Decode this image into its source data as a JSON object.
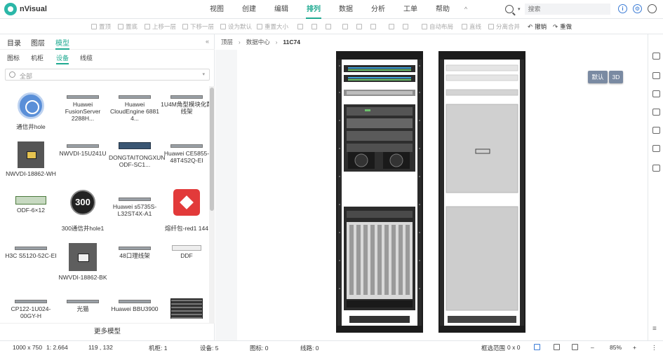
{
  "app": {
    "logo_text": "nVisual"
  },
  "menu": {
    "items": [
      "视图",
      "创建",
      "编辑",
      "排列",
      "数据",
      "分析",
      "工单",
      "帮助"
    ],
    "active_index": 3,
    "collapse_glyph": "^"
  },
  "search": {
    "placeholder": "搜索"
  },
  "top_icons": {
    "info": "i",
    "settings": "⚙"
  },
  "toolbar": {
    "front": "置顶",
    "back": "置底",
    "up": "上移一层",
    "down": "下移一层",
    "set_default": "设为默认",
    "reset_size": "重置大小",
    "auto_layout": "自动布局",
    "straight": "直线",
    "split_merge": "分离合并",
    "undo": "撤销",
    "redo": "重做"
  },
  "left_panel": {
    "tabs": [
      "目录",
      "图层",
      "模型"
    ],
    "active_tab": 2,
    "subtabs": [
      "图标",
      "机柜",
      "设备",
      "线缆"
    ],
    "active_subtab": 2,
    "filter_text": "全部",
    "collapse": "«",
    "items": [
      "通信井hole",
      "Huawei FusionServer 2288H...",
      "Huawei CloudEngine 6881 4...",
      "1U4M角型模块化配线架",
      "NWVDI-18862-WH",
      "NWVDI-15U241U",
      "DONGTAITONGXUN ODF-SC1...",
      "Huawei CE5855-48T4S2Q-EI",
      "ODF-6×12",
      "300通信井hole1",
      "Huawei s5735S-L32ST4X-A1",
      "熔纤包-red1 144",
      "H3C S5120-52C-EI",
      "NWVDI-18862-BK",
      "48口理线架",
      "DDF",
      "CP122-1U024-00GY-H",
      "光猫",
      "Huawei BBU3900",
      ""
    ],
    "more": "更多模型"
  },
  "breadcrumb": [
    "顶层",
    "数据中心",
    "11C74"
  ],
  "view_buttons": {
    "default": "默认",
    "three_d": "3D"
  },
  "status": {
    "canvas_size": "1000 x 750",
    "scale": "1: 2.664",
    "cursor": "119 , 132",
    "cabinets": "机柜: 1",
    "devices": "设备: 5",
    "icons": "图标: 0",
    "lines": "线路: 0",
    "selection": "框选范围",
    "selection_value": "0 x 0",
    "zoom": "85%",
    "minus": "–",
    "plus": "+",
    "more": "⋮"
  }
}
